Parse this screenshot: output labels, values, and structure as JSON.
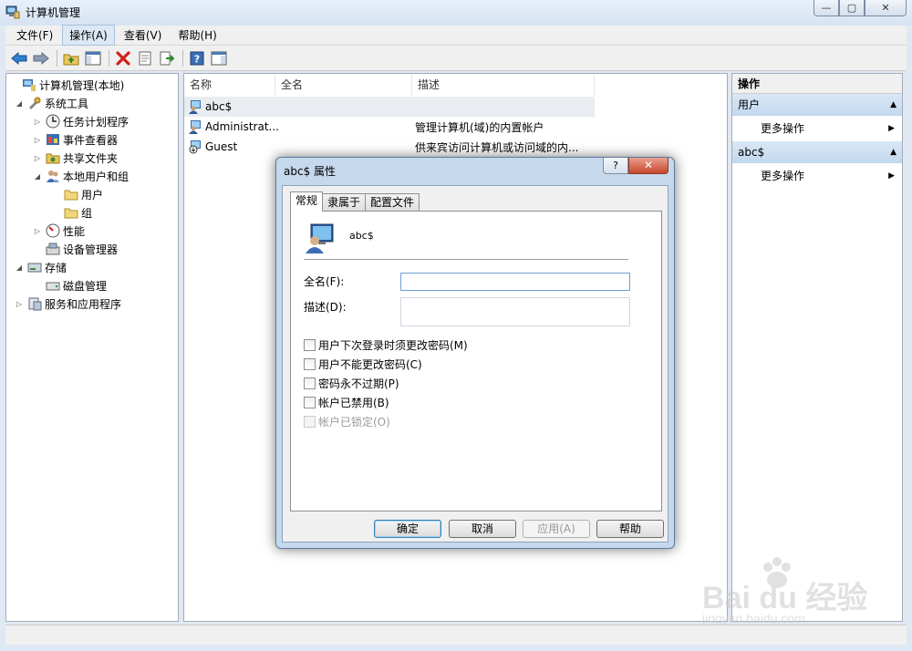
{
  "window": {
    "title": "计算机管理",
    "controls": {
      "minimize": "—",
      "restore": "▢",
      "close": "✕"
    }
  },
  "menubar": {
    "items": [
      {
        "label": "文件(F)"
      },
      {
        "label": "操作(A)"
      },
      {
        "label": "查看(V)"
      },
      {
        "label": "帮助(H)"
      }
    ]
  },
  "toolbar": {
    "icons": [
      "back-arrow-icon",
      "forward-arrow-icon",
      "up-folder-icon",
      "show-hide-tree-icon",
      "delete-icon",
      "properties-icon",
      "export-list-icon",
      "help-icon",
      "show-hide-action-pane-icon"
    ]
  },
  "tree": {
    "root": "计算机管理(本地)",
    "system_tools": "系统工具",
    "task_scheduler": "任务计划程序",
    "event_viewer": "事件查看器",
    "shared_folders": "共享文件夹",
    "local_users_groups": "本地用户和组",
    "users": "用户",
    "groups": "组",
    "performance": "性能",
    "device_manager": "设备管理器",
    "storage": "存储",
    "disk_management": "磁盘管理",
    "services_apps": "服务和应用程序"
  },
  "list": {
    "columns": {
      "name": "名称",
      "fullname": "全名",
      "description": "描述"
    },
    "rows": [
      {
        "name": "abc$",
        "fullname": "",
        "description": ""
      },
      {
        "name": "Administrat...",
        "fullname": "",
        "description": "管理计算机(域)的内置帐户"
      },
      {
        "name": "Guest",
        "fullname": "",
        "description": "供来宾访问计算机或访问域的内..."
      }
    ]
  },
  "actions": {
    "title": "操作",
    "sections": [
      {
        "header": "用户",
        "item": "更多操作"
      },
      {
        "header": "abc$",
        "item": "更多操作"
      }
    ]
  },
  "dialog": {
    "title": "abc$ 属性",
    "help_button": "?",
    "close_button": "✕",
    "tabs": [
      "常规",
      "隶属于",
      "配置文件"
    ],
    "username": "abc$",
    "fullname_label": "全名(F):",
    "fullname_value": "",
    "description_label": "描述(D):",
    "description_value": "",
    "checkboxes": [
      {
        "label": "用户下次登录时须更改密码(M)",
        "checked": false,
        "disabled": false
      },
      {
        "label": "用户不能更改密码(C)",
        "checked": false,
        "disabled": false
      },
      {
        "label": "密码永不过期(P)",
        "checked": false,
        "disabled": false
      },
      {
        "label": "帐户已禁用(B)",
        "checked": false,
        "disabled": false
      },
      {
        "label": "帐户已锁定(O)",
        "checked": false,
        "disabled": true
      }
    ],
    "buttons": {
      "ok": "确定",
      "cancel": "取消",
      "apply": "应用(A)",
      "help": "帮助"
    }
  },
  "watermark": {
    "brand": "Bai du 经验",
    "url": "jingyan.baidu.com"
  },
  "colors": {
    "accent": "#3c7fb1",
    "section_bg": "#c3d8ef",
    "close_red": "#c9462c"
  }
}
